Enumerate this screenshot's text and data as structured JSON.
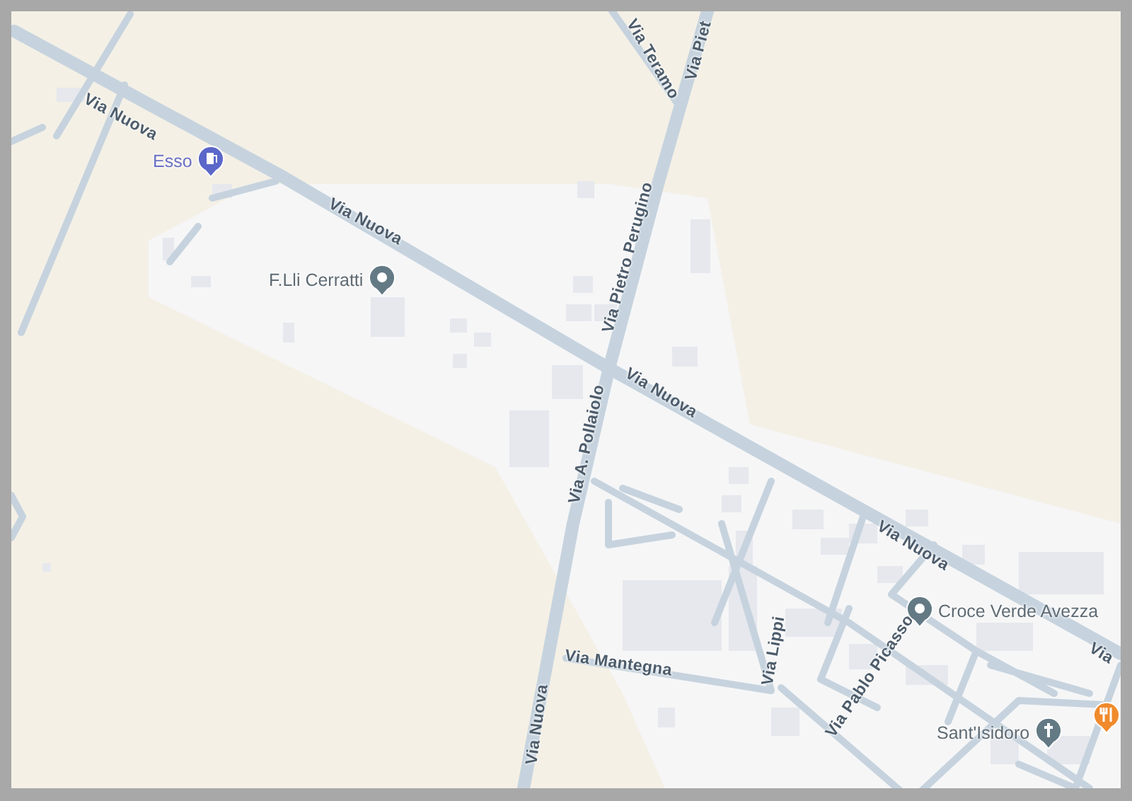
{
  "map": {
    "road_labels": [
      {
        "label": "Via Nuova"
      },
      {
        "label": "Via Nuova"
      },
      {
        "label": "Via Teramo"
      },
      {
        "label": "Via Piet"
      },
      {
        "label": "Via Pietro Perugino"
      },
      {
        "label": "Via Nuova"
      },
      {
        "label": "Via A. Pollaiolo"
      },
      {
        "label": "Via Nuova"
      },
      {
        "label": "Via"
      },
      {
        "label": "Via Nuova"
      },
      {
        "label": "Via Mantegna"
      },
      {
        "label": "Via Lippi"
      },
      {
        "label": "Via Pablo Picasso"
      }
    ],
    "places": [
      {
        "label": "Esso",
        "kind": "fuel"
      },
      {
        "label": "F.Lli Cerratti",
        "kind": "place"
      },
      {
        "label": "Croce Verde Avezza",
        "kind": "place"
      },
      {
        "label": "Sant'Isidoro",
        "kind": "church"
      },
      {
        "kind": "restaurant"
      }
    ]
  }
}
